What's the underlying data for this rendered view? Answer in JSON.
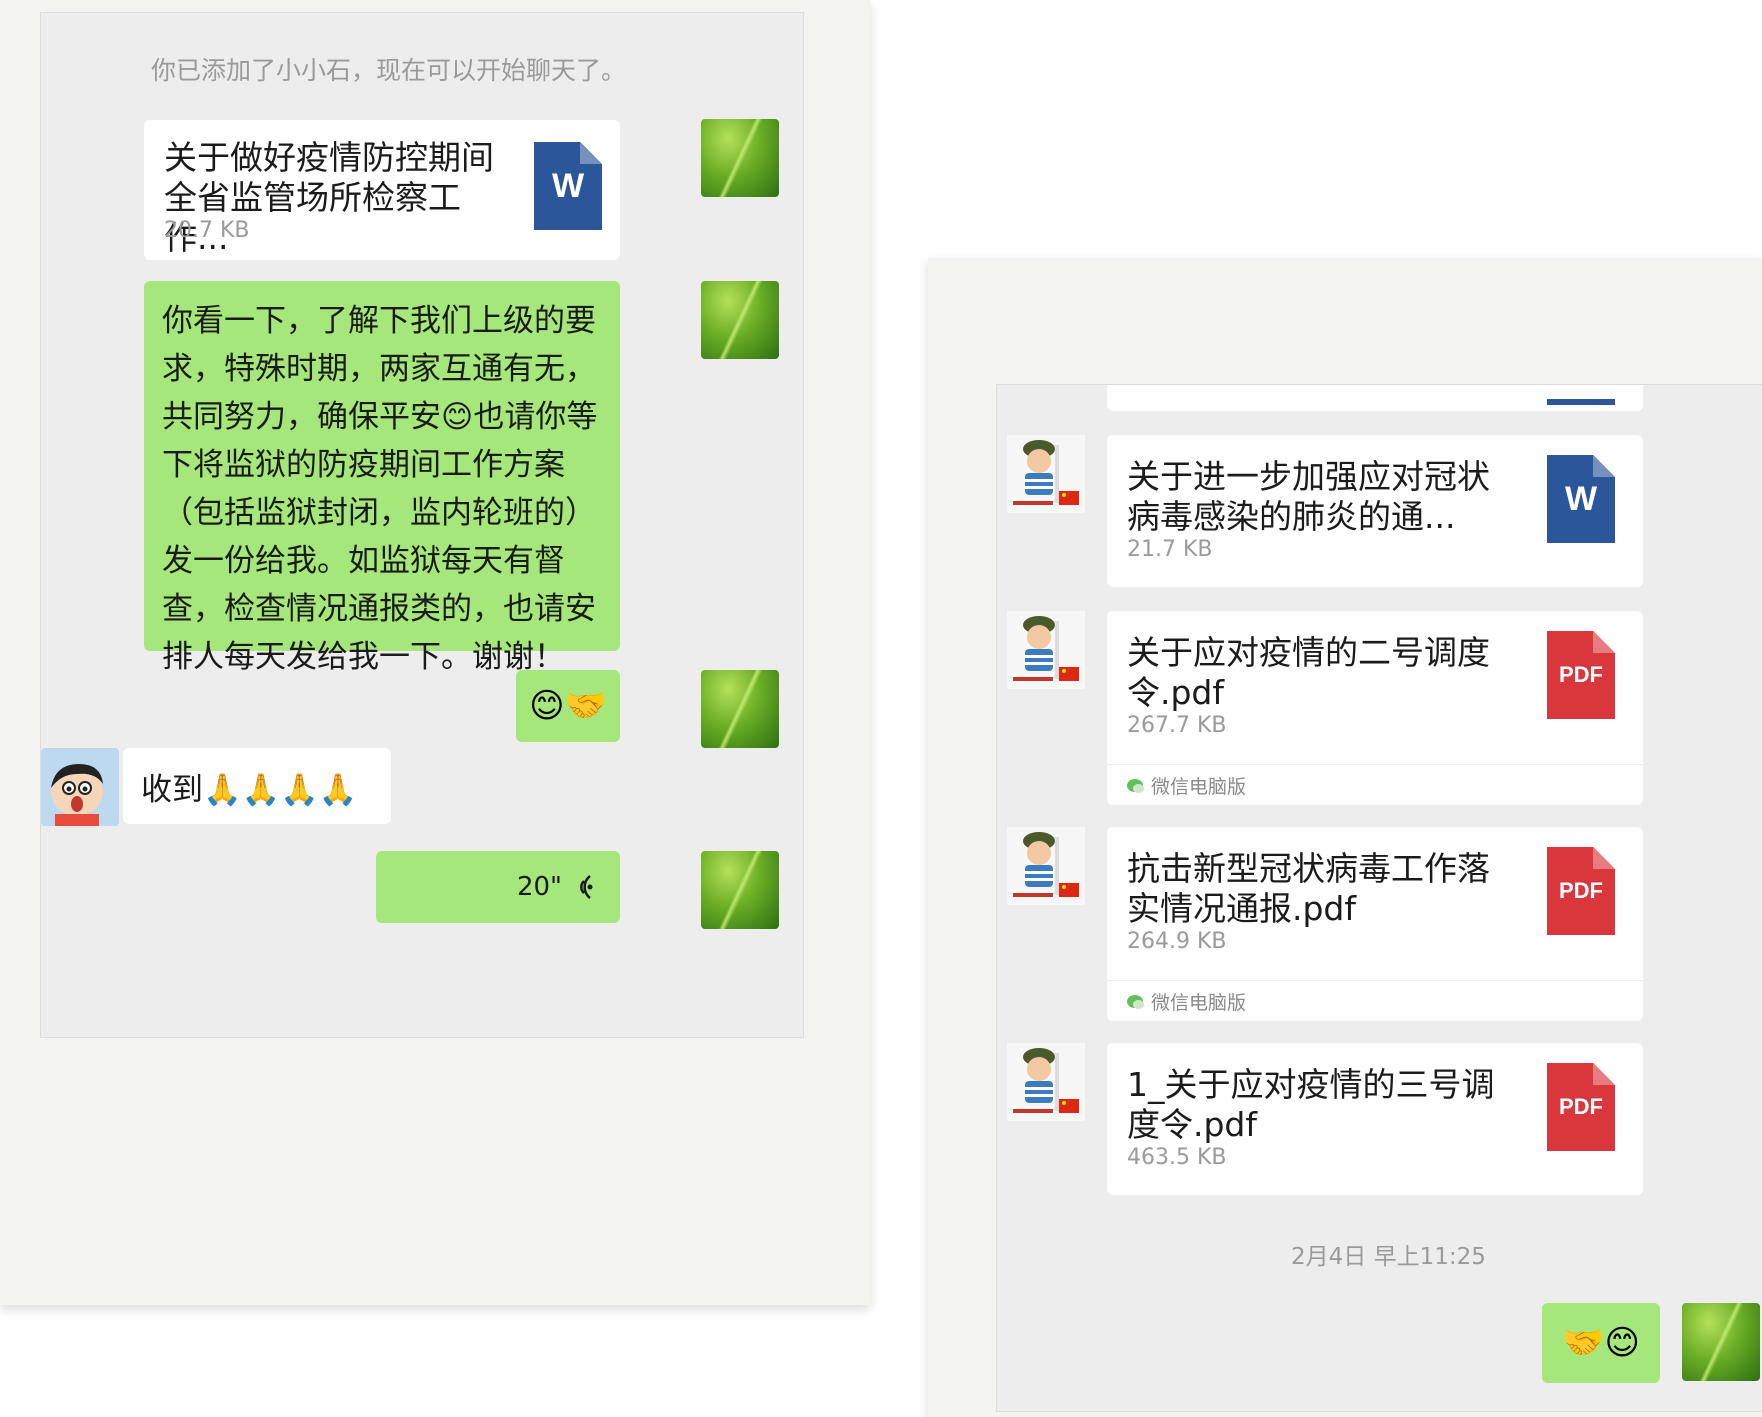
{
  "left_chat": {
    "system_notice": "你已添加了小小石，现在可以开始聊天了。",
    "file": {
      "title": "关于做好疫情防控期间全省监管场所检察工作...",
      "size": "20.7 KB",
      "type": "W"
    },
    "message": "你看一下，了解下我们上级的要求，特殊时期，两家互通有无，共同努力，确保平安😊也请你等下将监狱的防疫期间工作方案（包括监狱封闭，监内轮班的）发一份给我。如监狱每天有督查，检查情况通报类的，也请安排人每天发给我一下。谢谢！",
    "emoji_message": "😊🤝",
    "reply": "收到🙏🙏🙏🙏",
    "voice": {
      "duration": "20\"",
      "icon": "voice-wave-icon"
    }
  },
  "right_chat": {
    "files": [
      {
        "title": "关于进一步加强应对冠状病毒感染的肺炎的通...",
        "size": "21.7 KB",
        "type": "W",
        "footer": ""
      },
      {
        "title": "关于应对疫情的二号调度令.pdf",
        "size": "267.7 KB",
        "type": "PDF",
        "footer": "微信电脑版"
      },
      {
        "title": "抗击新型冠状病毒工作落实情况通报.pdf",
        "size": "264.9 KB",
        "type": "PDF",
        "footer": "微信电脑版"
      },
      {
        "title": "1_关于应对疫情的三号调度令.pdf",
        "size": "463.5 KB",
        "type": "PDF",
        "footer": ""
      }
    ],
    "timestamp": "2月4日 早上11:25",
    "emoji_message": "🤝😊"
  },
  "colors": {
    "bubble_green": "#a5e77a",
    "chat_background": "#ededed",
    "word_blue": "#2b579a",
    "pdf_red": "#d9373b"
  }
}
